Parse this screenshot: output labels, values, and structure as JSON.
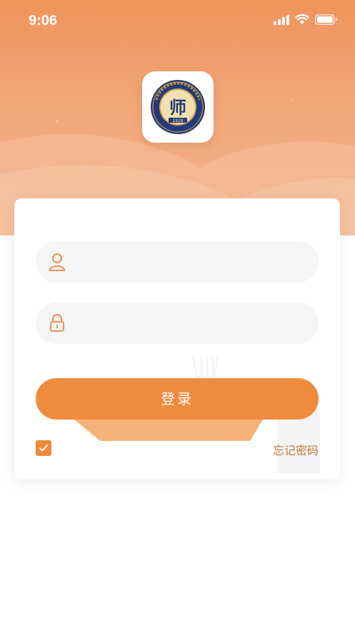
{
  "status_bar": {
    "time": "9:06",
    "icons": [
      "signal-icon",
      "wifi-icon",
      "battery-icon"
    ]
  },
  "logo": {
    "year_text": "1928",
    "char": "师",
    "arc_text": "浙江幼儿师范高等专科学校",
    "icon": "school-emblem-icon"
  },
  "login_form": {
    "username": {
      "icon": "user-icon",
      "value": "",
      "placeholder": ""
    },
    "password": {
      "icon": "lock-icon",
      "value": "",
      "placeholder": ""
    },
    "submit_label": "登录",
    "remember": {
      "checked": true,
      "label": "忘记密码"
    }
  },
  "colors": {
    "accent": "#ef8b3c",
    "hero_top": "#ef945a",
    "hero_bottom": "#f3b48f",
    "field_bg": "#f5f5f5"
  }
}
